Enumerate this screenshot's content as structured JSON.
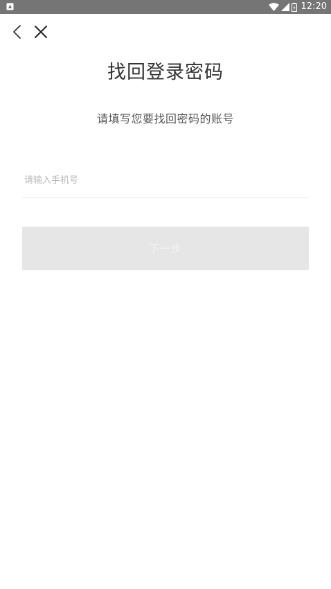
{
  "status_bar": {
    "time": "12:20",
    "icons": [
      "notification-icon",
      "wifi-icon",
      "signal-icon",
      "battery-icon"
    ]
  },
  "nav": {
    "back_icon": "chevron-left-icon",
    "close_icon": "close-icon"
  },
  "page": {
    "title": "找回登录密码",
    "subtitle": "请填写您要找回密码的账号"
  },
  "form": {
    "phone_value": "",
    "phone_placeholder": "请输入手机号",
    "next_label": "下一步"
  },
  "colors": {
    "status_bar": "#757575",
    "background": "#ffffff",
    "title": "#333333",
    "button_disabled": "#e6e6e6"
  }
}
